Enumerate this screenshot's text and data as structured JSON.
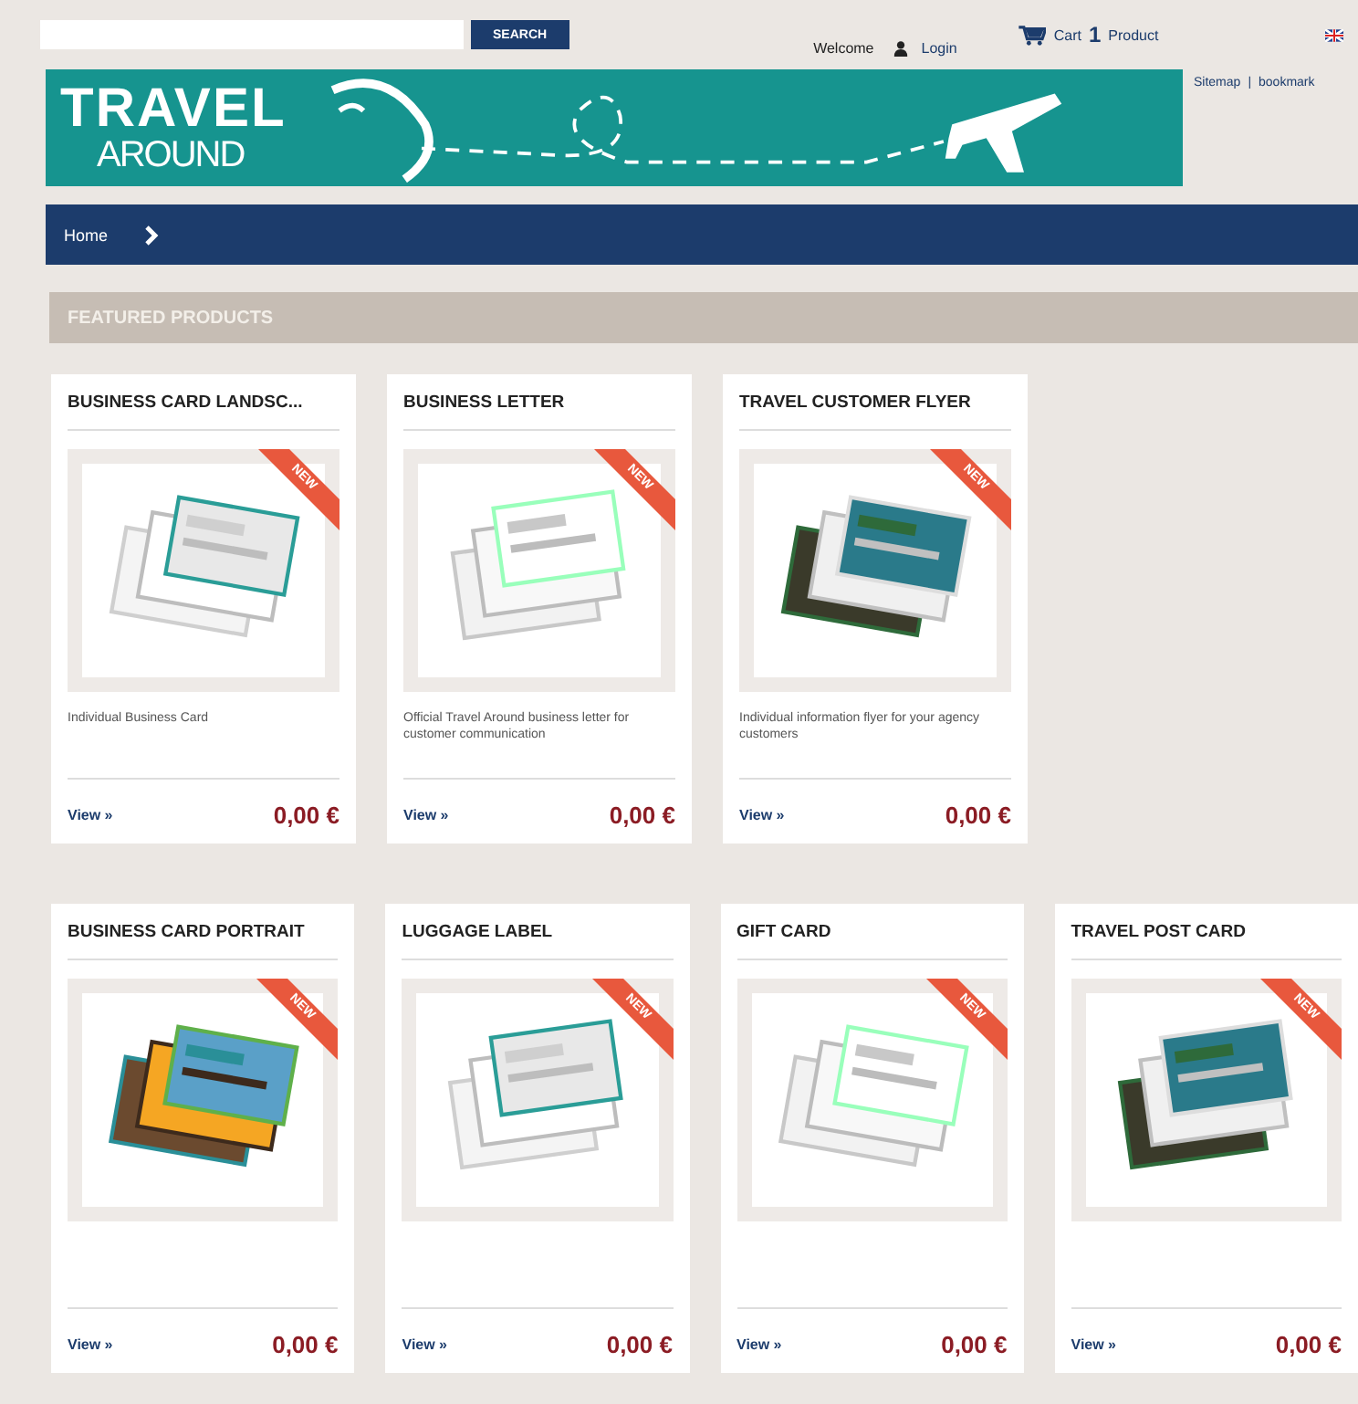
{
  "top_bar": {
    "search_button": "SEARCH",
    "welcome": "Welcome",
    "login": "Login",
    "cart": "Cart",
    "cart_count": "1",
    "cart_unit": "Product"
  },
  "banner": {
    "logo_top": "TRAVEL",
    "logo_bottom": "AROUND"
  },
  "links": [
    "Sitemap",
    "bookmark"
  ],
  "link_separator": "|",
  "breadcrumb": [
    "Home"
  ],
  "section_title": "FEATURED PRODUCTS",
  "product_rows": [
    [
      {
        "name": "BUSINESS CARD LANDSC...",
        "badge": "NEW",
        "description": "Individual Business Card",
        "link": "View »",
        "price": "0,00 €"
      },
      {
        "name": "BUSINESS LETTER",
        "badge": "NEW",
        "description": "Official Travel Around business letter for customer communication",
        "link": "View »",
        "price": "0,00 €"
      },
      {
        "name": "TRAVEL CUSTOMER FLYER",
        "badge": "NEW",
        "description": "Individual information flyer for your agency customers",
        "link": "View »",
        "price": "0,00 €"
      }
    ],
    [
      {
        "name": "BUSINESS CARD PORTRAIT",
        "badge": "NEW",
        "link": "View »",
        "price": "0,00 €"
      },
      {
        "name": "LUGGAGE LABEL",
        "badge": "NEW",
        "link": "View »",
        "price": "0,00 €"
      },
      {
        "name": "GIFT CARD",
        "badge": "NEW",
        "link": "View »",
        "price": "0,00 €"
      },
      {
        "name": "TRAVEL POST CARD",
        "badge": "NEW",
        "link": "View »",
        "price": "0,00 €"
      }
    ]
  ]
}
